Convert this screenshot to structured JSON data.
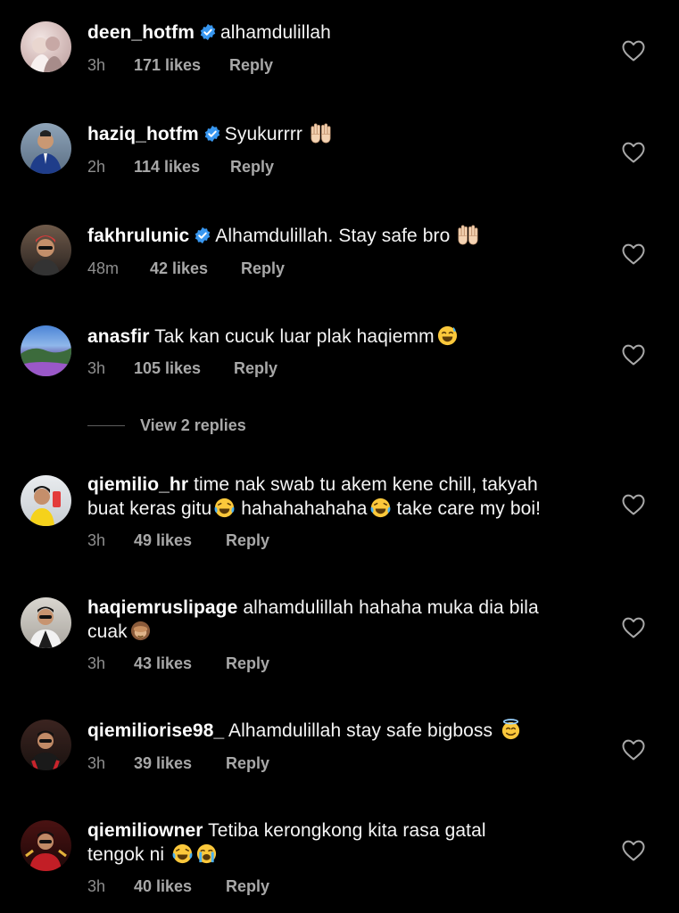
{
  "comments": [
    {
      "username": "deen_hotfm",
      "verified": true,
      "text": "alhamdulillah",
      "emojis": [],
      "time": "3h",
      "likes": "171 likes",
      "reply": "Reply"
    },
    {
      "username": "haziq_hotfm",
      "verified": true,
      "text": "Syukurrrr",
      "emojis": [
        "raised-hands"
      ],
      "time": "2h",
      "likes": "114 likes",
      "reply": "Reply"
    },
    {
      "username": "fakhrulunic",
      "verified": true,
      "text": "Alhamdulillah. Stay safe bro",
      "emojis": [
        "raised-hands"
      ],
      "time": "48m",
      "likes": "42 likes",
      "reply": "Reply"
    },
    {
      "username": "anasfir",
      "verified": false,
      "text": "Tak kan cucuk luar plak haqiemm",
      "emojis": [
        "grinning-sweat"
      ],
      "time": "3h",
      "likes": "105 likes",
      "reply": "Reply"
    },
    {
      "username": "qiemilio_hr",
      "verified": false,
      "text_line1": "time nak swab tu akem kene chill, takyah",
      "text_line2a": "buat keras gitu",
      "text_line2b": "hahahahahaha",
      "text_line2c": "take care my boi!",
      "emojis": [
        "tears-of-joy",
        "tears-of-joy"
      ],
      "time": "3h",
      "likes": "49 likes",
      "reply": "Reply"
    },
    {
      "username": "haqiemruslipage",
      "verified": false,
      "text_line1": "alhamdulillah hahaha muka dia bila",
      "text_line2": "cuak",
      "emojis": [
        "see-no-evil-monkey"
      ],
      "time": "3h",
      "likes": "43 likes",
      "reply": "Reply"
    },
    {
      "username": "qiemiliorise98_",
      "verified": false,
      "text": "Alhamdulillah stay safe bigboss",
      "emojis": [
        "smiling-halo"
      ],
      "time": "3h",
      "likes": "39 likes",
      "reply": "Reply"
    },
    {
      "username": "qiemiliowner",
      "verified": false,
      "text_line1": "Tetiba kerongkong kita rasa gatal",
      "text_line2": "tengok ni",
      "emojis": [
        "tears-of-joy",
        "loudly-crying"
      ],
      "time": "3h",
      "likes": "40 likes",
      "reply": "Reply"
    }
  ],
  "view_replies": "View 2 replies",
  "icons": {
    "verified": "verified-badge-icon",
    "like": "heart-outline-icon"
  },
  "colors": {
    "background": "#000000",
    "verified": "#3897f0",
    "muted": "#8e8e8e"
  }
}
